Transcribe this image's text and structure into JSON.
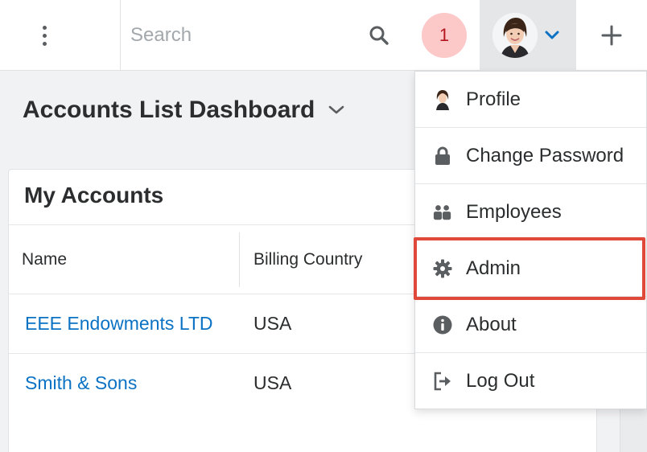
{
  "header": {
    "search_placeholder": "Search",
    "notification_count": "1",
    "accent_color": "#0b72c4",
    "notification_bg": "#fcc8c8"
  },
  "page": {
    "title": "Accounts List Dashboard"
  },
  "dashlet": {
    "title": "My Accounts",
    "columns": [
      "Name",
      "Billing Country"
    ],
    "rows": [
      {
        "name": "EEE Endowments LTD",
        "country": "USA"
      },
      {
        "name": "Smith & Sons",
        "country": "USA"
      }
    ]
  },
  "user_menu": {
    "items": [
      {
        "label": "Profile",
        "icon": "avatar-icon"
      },
      {
        "label": "Change Password",
        "icon": "lock-icon"
      },
      {
        "label": "Employees",
        "icon": "employees-icon"
      },
      {
        "label": "Admin",
        "icon": "gear-icon",
        "highlighted": true
      },
      {
        "label": "About",
        "icon": "info-icon"
      },
      {
        "label": "Log Out",
        "icon": "logout-icon"
      }
    ],
    "highlight_color": "#e0493a"
  }
}
